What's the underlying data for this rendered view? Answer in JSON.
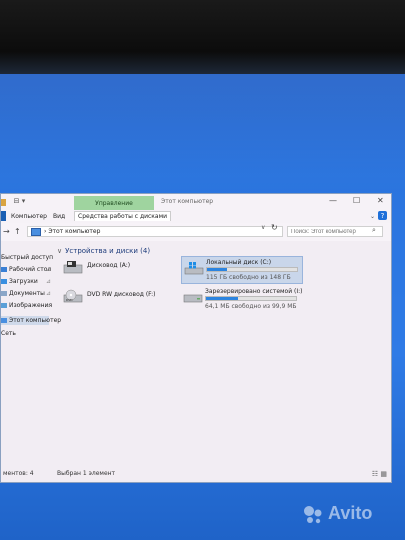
{
  "window": {
    "title": "Этот компьютер",
    "context_tab": "Управление",
    "controls": {
      "minimize": "—",
      "maximize": "☐",
      "close": "✕"
    }
  },
  "ribbon": {
    "tabs": [
      "Компьютер",
      "Вид",
      "Средства работы с дисками"
    ],
    "help": "?",
    "collapse": "⌄"
  },
  "address": {
    "path": "Этот компьютер",
    "search_placeholder": "Поиск: Этот компьютер"
  },
  "sidebar": {
    "items": [
      {
        "label": "Быстрый доступ"
      },
      {
        "label": "Рабочий стол"
      },
      {
        "label": "Загрузки"
      },
      {
        "label": "Документы"
      },
      {
        "label": "Изображения"
      },
      {
        "label": "Этот компьютер"
      },
      {
        "label": "Сеть"
      }
    ]
  },
  "content": {
    "group_title": "Устройства и диски (4)",
    "drives": [
      {
        "name": "Дисковод (A:)"
      },
      {
        "name": "DVD RW дисковод (F:)"
      },
      {
        "name": "Локальный диск (C:)",
        "free_text": "115 ГБ свободно из 148 ГБ",
        "used_fraction": 0.22
      },
      {
        "name": "Зарезервировано системой (I:)",
        "free_text": "64,1 МБ свободно из 99,9 МБ",
        "used_fraction": 0.36
      }
    ]
  },
  "status": {
    "items_count": "ментов: 4",
    "selected": "Выбран 1 элемент"
  },
  "watermark": "Avito",
  "colors": {
    "accent": "#2c84e0",
    "context_tab": "#9fd49f",
    "desktop": "#2a74de"
  }
}
